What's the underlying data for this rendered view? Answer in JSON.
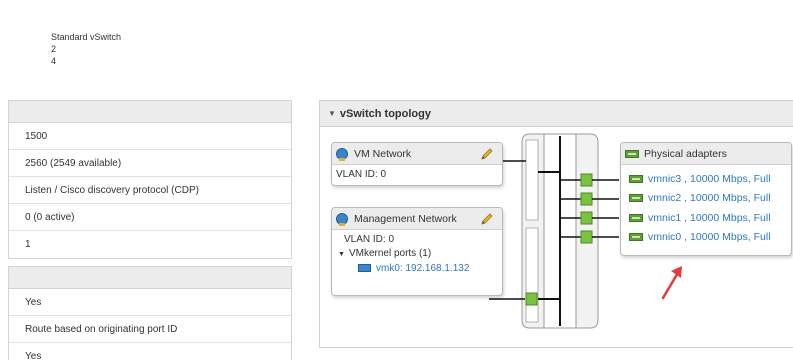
{
  "summary": {
    "type": "Standard vSwitch",
    "port_groups": "2",
    "uplinks": "4"
  },
  "properties": {
    "rows": [
      "1500",
      "2560 (2549 available)",
      "Listen / Cisco discovery protocol (CDP)",
      "0 (0 active)",
      "1"
    ]
  },
  "policies": {
    "rows": [
      "Yes",
      "Route based on originating port ID",
      "Yes"
    ]
  },
  "topology": {
    "title": "vSwitch topology",
    "vm_network": {
      "name": "VM Network",
      "vlan": "VLAN ID: 0"
    },
    "management_network": {
      "name": "Management Network",
      "vlan": "VLAN ID: 0",
      "vmkernel_label": "VMkernel ports (1)",
      "vmk": "vmk0: 192.168.1.132"
    },
    "physical_adapters": {
      "title": "Physical adapters",
      "items": [
        "vmnic3 , 10000 Mbps, Full",
        "vmnic2 , 10000 Mbps, Full",
        "vmnic1 , 10000 Mbps, Full",
        "vmnic0 , 10000 Mbps, Full"
      ]
    }
  },
  "colors": {
    "link": "#3176c3",
    "port_green": "#7cc242",
    "arrow": "#e23b3b",
    "panel_header": "#ececec"
  }
}
